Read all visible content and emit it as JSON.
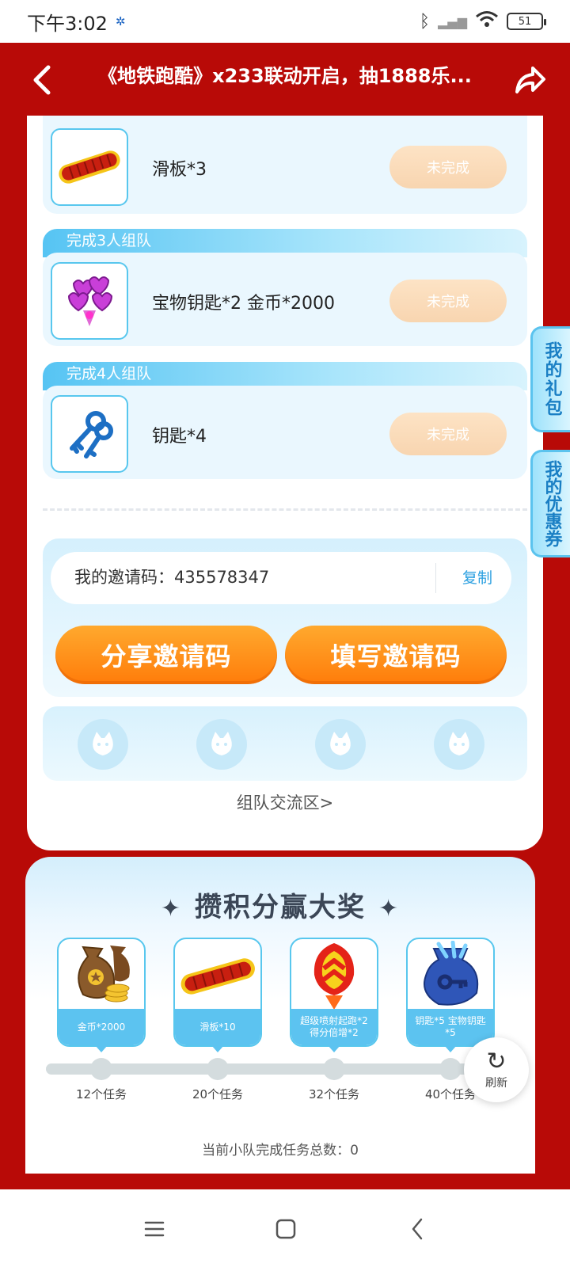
{
  "status_bar": {
    "time": "下午3:02",
    "battery": "51"
  },
  "header": {
    "title": "《地铁跑酷》x233联动开启，抽1888乐..."
  },
  "tasks": [
    {
      "tag": "",
      "reward": "滑板*3",
      "status": "未完成"
    },
    {
      "tag": "完成3人组队",
      "reward": "宝物钥匙*2 金币*2000",
      "status": "未完成"
    },
    {
      "tag": "完成4人组队",
      "reward": "钥匙*4",
      "status": "未完成"
    }
  ],
  "invite": {
    "code_label": "我的邀请码：435578347",
    "copy": "复制",
    "share_button": "分享邀请码",
    "fill_button": "填写邀请码"
  },
  "forum_link": "组队交流区>",
  "side_tabs": {
    "gift": "我的礼包",
    "coupon": "我的优惠券"
  },
  "rewards": {
    "title": "攒积分赢大奖",
    "milestones": [
      {
        "label": "金币*2000",
        "tasks": "12个任务"
      },
      {
        "label": "滑板*10",
        "tasks": "20个任务"
      },
      {
        "label": "超级喷射起跑*2 得分倍增*2",
        "tasks": "32个任务"
      },
      {
        "label": "钥匙*5 宝物钥匙*5",
        "tasks": "40个任务"
      }
    ],
    "refresh": "刷新",
    "team_total": "当前小队完成任务总数：0"
  },
  "colors": {
    "brand_red": "#b80a07",
    "accent_orange": "#ff8a14",
    "accent_blue": "#58c7ee"
  }
}
